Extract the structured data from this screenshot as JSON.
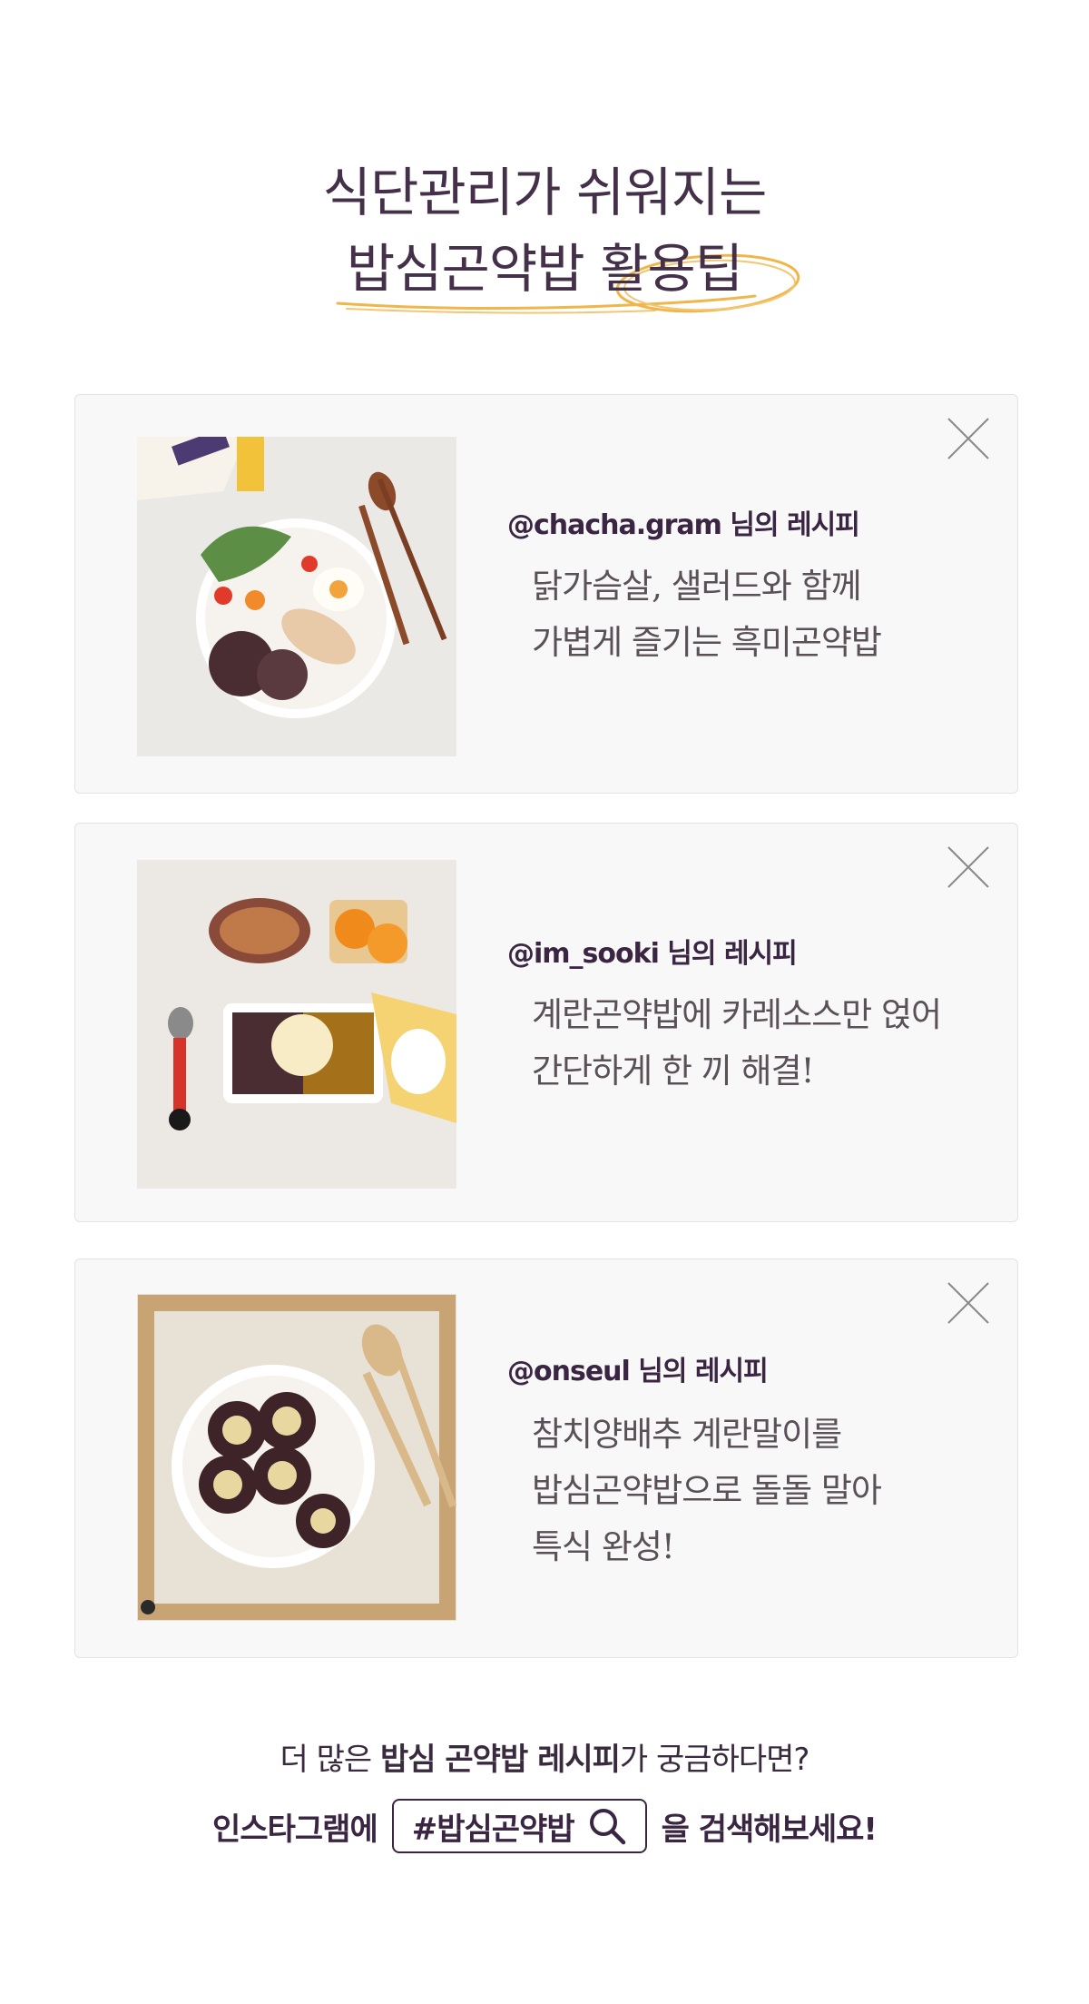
{
  "title": {
    "line1": "식단관리가 쉬워지는",
    "line2": "밥심곤약밥 활용팁"
  },
  "cards": [
    {
      "user": "@chacha.gram 님의 레시피",
      "desc": [
        "닭가슴살, 샐러드와 함께",
        "가볍게 즐기는 흑미곤약밥"
      ],
      "photo": "rice-salad-chicken-plate"
    },
    {
      "user": "@im_sooki 님의 레시피",
      "desc": [
        "계란곤약밥에 카레소스만 얹어",
        "간단하게 한 끼 해결!"
      ],
      "photo": "curry-egg-rice-tray"
    },
    {
      "user": "@onseul 님의 레시피",
      "desc": [
        "참치양배추 계란말이를",
        "밥심곤약밥으로 돌돌 말아",
        "특식 완성!"
      ],
      "photo": "rolled-rice-egg-plate"
    }
  ],
  "footer": {
    "line1_prefix": "더 많은 ",
    "line1_bold": "밥심 곤약밥 레시피",
    "line1_suffix": "가 궁금하다면?",
    "line2_prefix": "인스타그램에",
    "hashtag": "#밥심곤약밥",
    "line2_suffix": "을 검색해보세요!"
  },
  "colors": {
    "accent_orange": "#f0b64a",
    "text_purple": "#3a2642",
    "card_bg": "#f8f8f8"
  },
  "icons": {
    "close": "close-icon",
    "search": "search-icon"
  }
}
